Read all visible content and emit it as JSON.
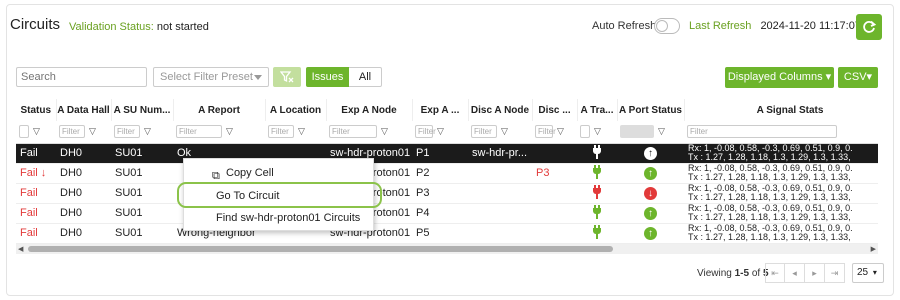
{
  "header": {
    "title": "Circuits",
    "validation_label": "Validation Status:",
    "validation_value": "not started",
    "auto_refresh_label": "Auto Refresh",
    "last_refresh_label": "Last Refresh",
    "last_refresh_value": "2024-11-20 11:17:07"
  },
  "toolbar": {
    "search_placeholder": "Search",
    "filter_preset_placeholder": "Select Filter Preset",
    "issues_label": "Issues",
    "all_label": "All",
    "displayed_columns_label": "Displayed Columns ▾",
    "csv_label": "CSV▾"
  },
  "table": {
    "columns": [
      "Status",
      "A Data Hall",
      "A SU Num...",
      "A Report",
      "A Location",
      "Exp A Node",
      "Exp A ...",
      "Disc A Node",
      "Disc ...",
      "A Tra...",
      "A Port Status",
      "A Signal Stats"
    ],
    "filter_placeholder": "Filter",
    "rows": [
      {
        "status": "Fail",
        "hall": "DH0",
        "su": "SU01",
        "report": "Ok",
        "location": "",
        "exp_node": "sw-hdr-proton01",
        "exp_port": "P1",
        "disc_node": "sw-hdr-pr...",
        "disc_port": "",
        "rx": "Rx: 1, -0.08, 0.58, -0.3, 0.69, 0.51, 0.9, 0.",
        "tx": "Tx : 1.27, 1.28, 1.18, 1.3, 1.29, 1.3, 1.33,"
      },
      {
        "status": "Fail ↓",
        "hall": "DH0",
        "su": "SU01",
        "report": "",
        "location": "",
        "exp_node": "sw-hdr-proton01",
        "exp_port": "P2",
        "disc_node": "",
        "disc_port": "P3",
        "rx": "Rx: 1, -0.08, 0.58, -0.3, 0.69, 0.51, 0.9, 0.",
        "tx": "Tx : 1.27, 1.28, 1.18, 1.3, 1.29, 1.3, 1.33,"
      },
      {
        "status": "Fail",
        "hall": "DH0",
        "su": "SU01",
        "report": "",
        "location": "",
        "exp_node": "sw-hdr-proton01",
        "exp_port": "P3",
        "disc_node": "",
        "disc_port": "",
        "rx": "Rx: 1, -0.08, 0.58, -0.3, 0.69, 0.51, 0.9, 0.",
        "tx": "Tx : 1.27, 1.28, 1.18, 1.3, 1.29, 1.3, 1.33,"
      },
      {
        "status": "Fail",
        "hall": "DH0",
        "su": "SU01",
        "report": "",
        "location": "",
        "exp_node": "sw-hdr-proton01",
        "exp_port": "P4",
        "disc_node": "",
        "disc_port": "",
        "rx": "Rx: 1, -0.08, 0.58, -0.3, 0.69, 0.51, 0.9, 0.",
        "tx": "Tx : 1.27, 1.28, 1.18, 1.3, 1.29, 1.3, 1.33,"
      },
      {
        "status": "Fail",
        "hall": "DH0",
        "su": "SU01",
        "report": "Wrong-neighbor",
        "location": "",
        "exp_node": "sw-hdr-proton01",
        "exp_port": "P5",
        "disc_node": "",
        "disc_port": "",
        "rx": "Rx: 1, -0.08, 0.58, -0.3, 0.69, 0.51, 0.9, 0.",
        "tx": "Tx : 1.27, 1.28, 1.18, 1.3, 1.29, 1.3, 1.33,"
      }
    ]
  },
  "context_menu": {
    "copy_cell": "Copy Cell",
    "go_to_circuit": "Go To Circuit",
    "find_circuits": "Find sw-hdr-proton01 Circuits"
  },
  "pagination": {
    "viewing_prefix": "Viewing ",
    "range": "1-5",
    "of_word": " of ",
    "total": "5",
    "page_size": "25"
  },
  "colors": {
    "accent": "#6db52c",
    "fail": "#e23a3a",
    "selected_row": "#1b1b1b"
  },
  "icons": [
    "refresh-icon",
    "funnel-icon",
    "filter-off-icon",
    "plug-icon",
    "arrow-up-circle-icon",
    "arrow-down-circle-icon",
    "copy-icon",
    "chevron-down-icon"
  ]
}
